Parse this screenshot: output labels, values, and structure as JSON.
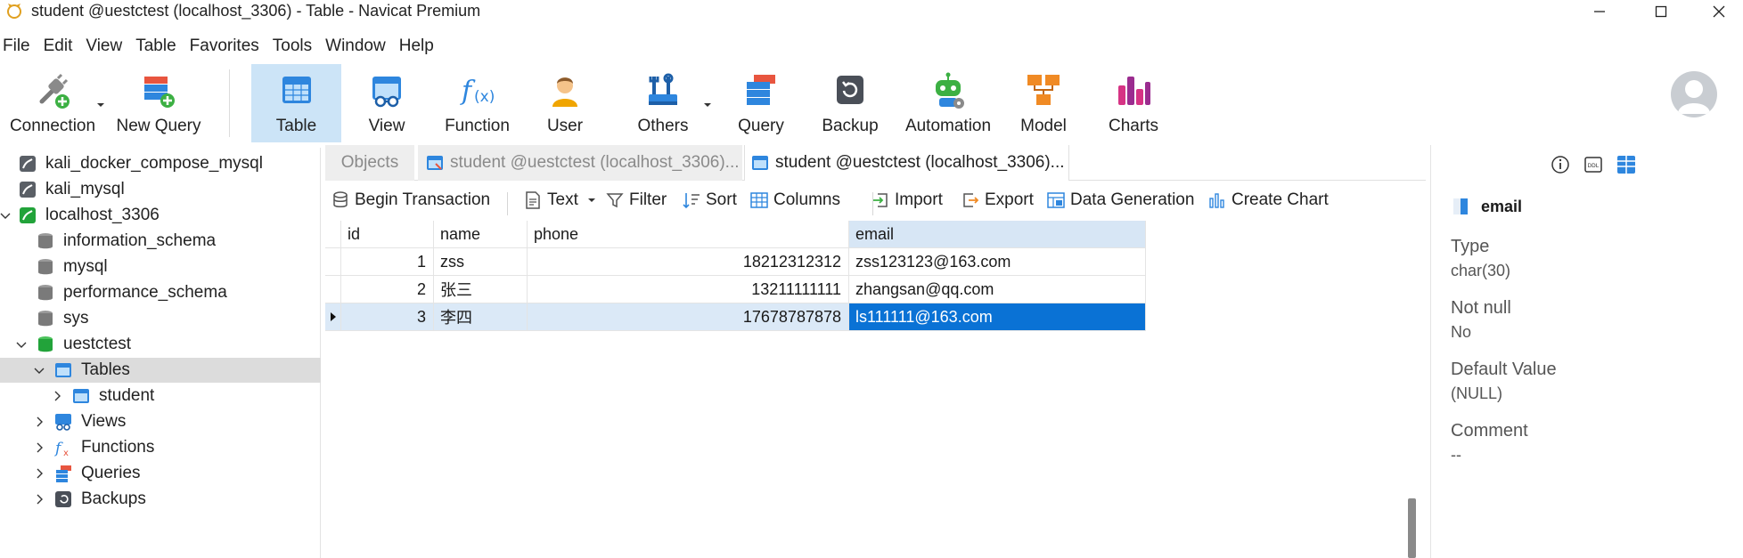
{
  "window": {
    "title": "student @uestctest (localhost_3306) - Table - Navicat Premium"
  },
  "menu": [
    "File",
    "Edit",
    "View",
    "Table",
    "Favorites",
    "Tools",
    "Window",
    "Help"
  ],
  "toolbar": {
    "connection": "Connection",
    "new_query": "New Query",
    "table": "Table",
    "view": "View",
    "function": "Function",
    "user": "User",
    "others": "Others",
    "query": "Query",
    "backup": "Backup",
    "automation": "Automation",
    "model": "Model",
    "charts": "Charts"
  },
  "tree": {
    "items": [
      {
        "label": "kali_docker_compose_mysql"
      },
      {
        "label": "kali_mysql"
      },
      {
        "label": "localhost_3306"
      },
      {
        "label": "information_schema"
      },
      {
        "label": "mysql"
      },
      {
        "label": "performance_schema"
      },
      {
        "label": "sys"
      },
      {
        "label": "uestctest"
      },
      {
        "label": "Tables"
      },
      {
        "label": "student"
      },
      {
        "label": "Views"
      },
      {
        "label": "Functions"
      },
      {
        "label": "Queries"
      },
      {
        "label": "Backups"
      }
    ]
  },
  "tabs": {
    "objects": "Objects",
    "tab1": "student @uestctest (localhost_3306)...",
    "tab2": "student @uestctest (localhost_3306)..."
  },
  "object_toolbar": {
    "begin_transaction": "Begin Transaction",
    "text": "Text",
    "filter": "Filter",
    "sort": "Sort",
    "columns": "Columns",
    "import": "Import",
    "export": "Export",
    "data_generation": "Data Generation",
    "create_chart": "Create Chart"
  },
  "grid": {
    "columns": [
      "id",
      "name",
      "phone",
      "email"
    ],
    "rows": [
      [
        "1",
        "zss",
        "18212312312",
        "zss123123@163.com"
      ],
      [
        "2",
        "张三",
        "13211111111",
        "zhangsan@qq.com"
      ],
      [
        "3",
        "李四",
        "17678787878",
        "ls111111@163.com"
      ]
    ]
  },
  "field_panel": {
    "field_name": "email",
    "type_label": "Type",
    "type_value": "char(30)",
    "notnull_label": "Not null",
    "notnull_value": "No",
    "default_label": "Default Value",
    "default_value": "(NULL)",
    "comment_label": "Comment",
    "comment_value": "--"
  },
  "colors": {
    "accent": "#0a72d5",
    "selected_row": "#dbe9f7",
    "active_tool": "#cce4f7"
  }
}
